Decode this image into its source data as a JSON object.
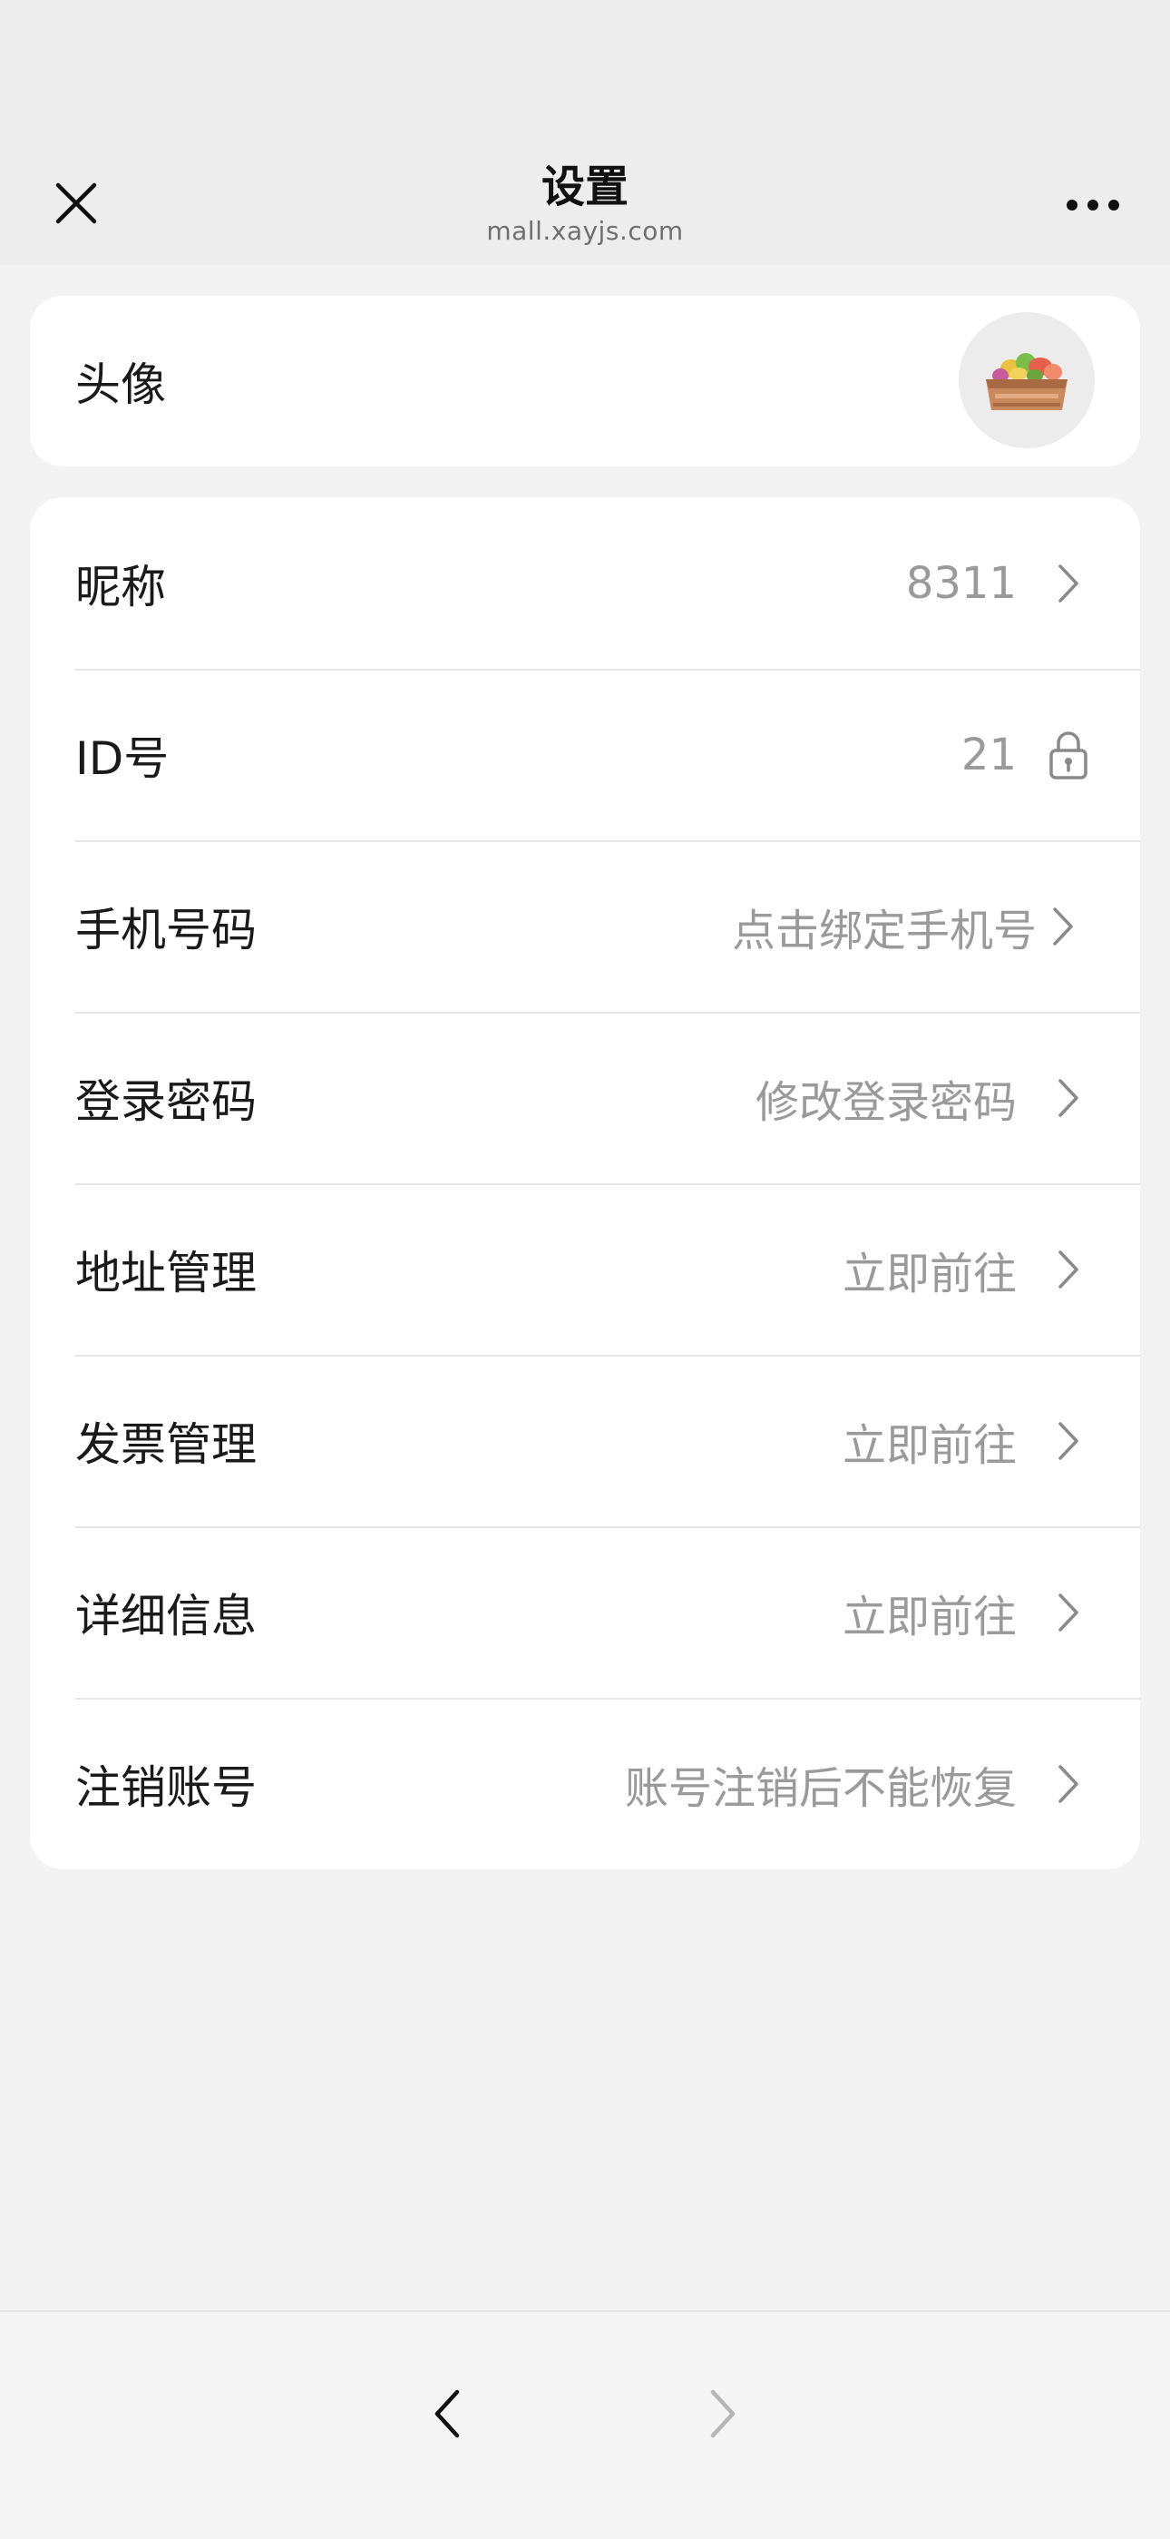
{
  "header": {
    "title": "设置",
    "subtitle": "mall.xayjs.com"
  },
  "avatar_row": {
    "label": "头像",
    "image": "vegetable-crate-avatar"
  },
  "rows": [
    {
      "label": "昵称",
      "value": "8311",
      "icon": "chevron-right-icon"
    },
    {
      "label": "ID号",
      "value": "21",
      "icon": "lock-icon"
    },
    {
      "label": "手机号码",
      "value": "点击绑定手机号",
      "icon": "chevron-right-icon"
    },
    {
      "label": "登录密码",
      "value": "修改登录密码",
      "icon": "chevron-right-icon"
    },
    {
      "label": "地址管理",
      "value": "立即前往",
      "icon": "chevron-right-icon"
    },
    {
      "label": "发票管理",
      "value": "立即前往",
      "icon": "chevron-right-icon"
    },
    {
      "label": "详细信息",
      "value": "立即前往",
      "icon": "chevron-right-icon"
    },
    {
      "label": "注销账号",
      "value": "账号注销后不能恢复",
      "icon": "chevron-right-icon"
    }
  ],
  "colors": {
    "header_bg": "#ededed",
    "page_bg": "#f3f3f3",
    "card_bg": "#ffffff",
    "label_text": "#1a1a1a",
    "value_text": "#9a9a9a",
    "divider": "#e6e6e6"
  }
}
